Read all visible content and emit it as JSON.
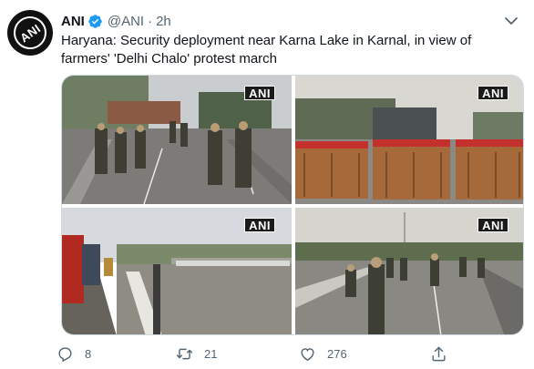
{
  "account": {
    "display_name": "ANI",
    "handle": "@ANI",
    "separator": "·",
    "time": "2h",
    "avatar_text": "ANI"
  },
  "tweet": {
    "text": "Haryana: Security deployment near Karna Lake in Karnal, in view of farmers' 'Delhi Chalo' protest march"
  },
  "media": {
    "watermark": "ANI",
    "photos": [
      {
        "watermark": "ANI"
      },
      {
        "watermark": "ANI"
      },
      {
        "watermark": "ANI"
      },
      {
        "watermark": "ANI"
      }
    ]
  },
  "actions": {
    "reply_count": "8",
    "retweet_count": "21",
    "like_count": "276"
  },
  "colors": {
    "text_primary": "#0f1419",
    "text_secondary": "#536471",
    "verified_blue": "#1d9bf0",
    "border": "#cfd9de"
  },
  "icons": {
    "verified": "verified-badge-icon",
    "more": "more-options-icon",
    "reply": "reply-icon",
    "retweet": "retweet-icon",
    "like": "heart-icon",
    "share": "share-icon"
  }
}
